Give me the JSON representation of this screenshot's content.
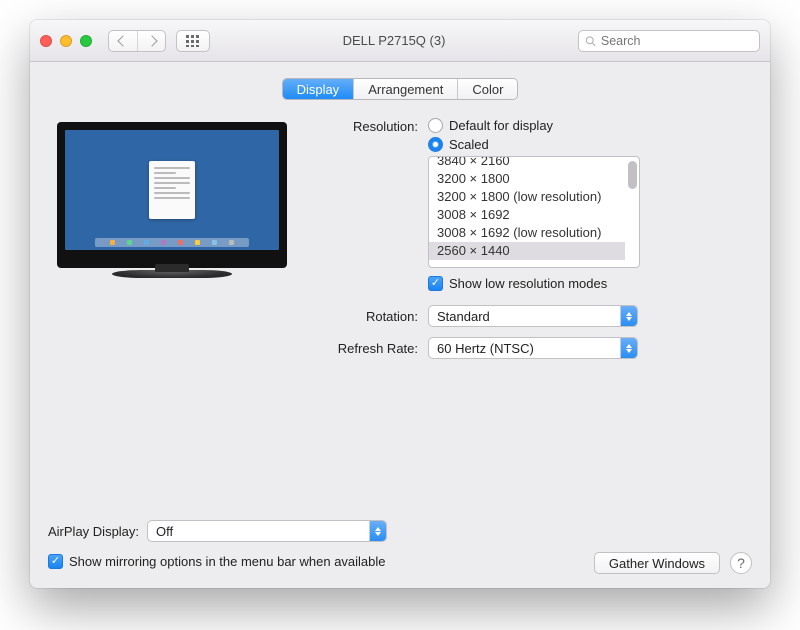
{
  "window": {
    "title": "DELL P2715Q (3)",
    "search_placeholder": "Search"
  },
  "tabs": [
    "Display",
    "Arrangement",
    "Color"
  ],
  "labels": {
    "resolution": "Resolution:",
    "rotation": "Rotation:",
    "refresh_rate": "Refresh Rate:",
    "airplay": "AirPlay Display:"
  },
  "resolution": {
    "default_option": "Default for display",
    "scaled_option": "Scaled",
    "selected": "Scaled",
    "list": [
      "3840 × 2160",
      "3200 × 1800",
      "3200 × 1800 (low resolution)",
      "3008 × 1692",
      "3008 × 1692 (low resolution)",
      "2560 × 1440"
    ],
    "selected_item": "2560 × 1440",
    "show_low_res_label": "Show low resolution modes",
    "show_low_res_checked": true
  },
  "rotation": {
    "value": "Standard"
  },
  "refresh_rate": {
    "value": "60 Hertz (NTSC)"
  },
  "airplay": {
    "value": "Off"
  },
  "mirroring": {
    "label": "Show mirroring options in the menu bar when available",
    "checked": true
  },
  "buttons": {
    "gather": "Gather Windows",
    "help": "?"
  },
  "dock_colors": [
    "#f5b041",
    "#58d68d",
    "#5dade2",
    "#af7ac5",
    "#ec7063",
    "#f4d03f",
    "#85c1e9",
    "#bbb"
  ]
}
